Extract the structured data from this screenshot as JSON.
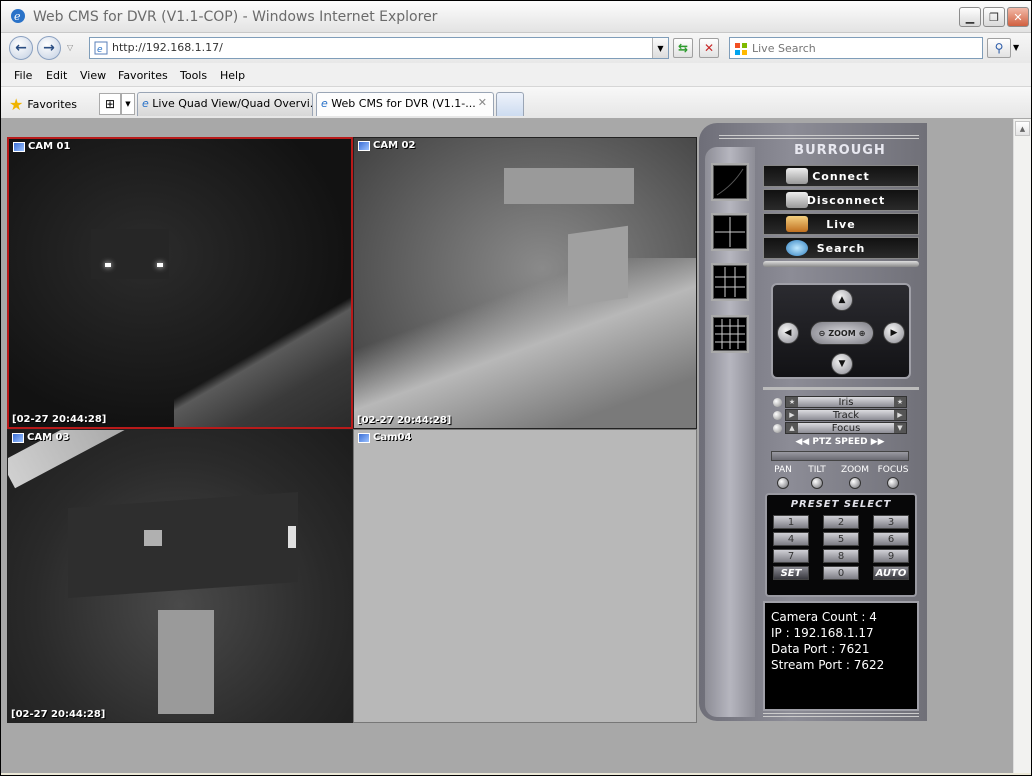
{
  "window": {
    "title": "Web CMS for DVR (V1.1-COP) - Windows Internet Explorer",
    "minimize_icon": "minimize-icon",
    "restore_icon": "restore-icon",
    "close_icon": "close-icon"
  },
  "address": {
    "url": "http://192.168.1.17/",
    "search_placeholder": "Live Search"
  },
  "menu": [
    "File",
    "Edit",
    "View",
    "Favorites",
    "Tools",
    "Help"
  ],
  "favorites_label": "Favorites",
  "tabs": [
    {
      "label": "Live Quad View/Quad Overvi...",
      "active": false
    },
    {
      "label": "Web CMS for DVR (V1.1-...",
      "active": true
    }
  ],
  "cameras": [
    {
      "label": "CAM 01",
      "timestamp": "[02-27 20:44:28]",
      "selected": true
    },
    {
      "label": "CAM 02",
      "timestamp": "[02-27 20:44:28]",
      "selected": false
    },
    {
      "label": "CAM 03",
      "timestamp": "[02-27 20:44:28]",
      "selected": false
    },
    {
      "label": "Cam04",
      "timestamp": "",
      "selected": false
    }
  ],
  "panel": {
    "brand": "BURROUGH",
    "buttons": [
      "Connect",
      "Disconnect",
      "Live",
      "Search"
    ],
    "zoom_label": "ZOOM",
    "controls": [
      "Iris",
      "Track",
      "Focus"
    ],
    "ptz_speed": "◀◀ PTZ SPEED ▶▶",
    "modes": [
      "PAN",
      "TILT",
      "ZOOM",
      "FOCUS"
    ],
    "preset_title": "PRESET SELECT",
    "preset_keys": [
      "1",
      "2",
      "3",
      "4",
      "5",
      "6",
      "7",
      "8",
      "9",
      "SET",
      "0",
      "AUTO"
    ],
    "info": [
      "Camera Count : 4",
      "IP : 192.168.1.17",
      "Data Port : 7621",
      "Stream Port : 7622"
    ]
  }
}
